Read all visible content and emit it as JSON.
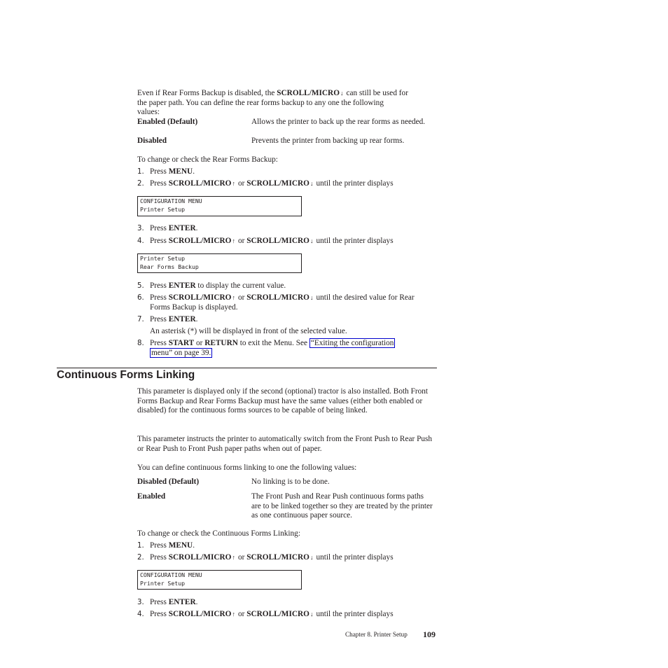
{
  "intro": {
    "text_before": "Even if Rear Forms Backup is disabled, the ",
    "key": "SCROLL/MICRO",
    "text_after_line1": "can still be used for",
    "line2": "the paper path. You can define the rear forms backup to any one the following",
    "line3": "values:"
  },
  "rear_values": [
    {
      "term": "Enabled (Default)",
      "desc": "Allows the printer to back up the rear forms as needed."
    },
    {
      "term": "Disabled",
      "desc": "Prevents the printer from backing up rear forms."
    }
  ],
  "rear_procedure": {
    "intro": "To change or check the Rear Forms Backup:",
    "steps": {
      "s1": {
        "num": "1.",
        "pre": "Press ",
        "key": "MENU",
        "post": "."
      },
      "s2": {
        "num": "2.",
        "pre": "Press ",
        "key1": "SCROLL/MICRO",
        "mid": "or ",
        "key2": "SCROLL/MICRO",
        "post": "until the printer displays"
      },
      "lcd1": {
        "line1": "CONFIGURATION MENU",
        "line2": "Printer Setup"
      },
      "s3": {
        "num": "3.",
        "pre": "Press ",
        "key": "ENTER",
        "post": "."
      },
      "s4": {
        "num": "4.",
        "pre": "Press ",
        "key1": "SCROLL/MICRO",
        "mid": "or ",
        "key2": "SCROLL/MICRO",
        "post": "until the printer displays"
      },
      "lcd2": {
        "line1": "Printer Setup",
        "line2": "Rear Forms Backup"
      },
      "s5": {
        "num": "5.",
        "pre": "Press ",
        "key": "ENTER",
        "post": " to display the current value."
      },
      "s6": {
        "num": "6.",
        "pre": "Press ",
        "key1": "SCROLL/MICRO",
        "mid": "or ",
        "key2": "SCROLL/MICRO",
        "post": "until the desired value for Rear",
        "line2": "Forms Backup is displayed."
      },
      "s7": {
        "num": "7.",
        "pre": "Press ",
        "key": "ENTER",
        "post": ".",
        "note": "An asterisk (*) will be displayed in front of the selected value."
      },
      "s8": {
        "num": "8.",
        "pre": "Press ",
        "key1": "START",
        "mid": " or ",
        "key2": "RETURN",
        "post": " to exit the Menu. See ",
        "link_line1": "“Exiting the configuration",
        "link_line2": "menu” on page 39."
      }
    }
  },
  "section": {
    "title": "Continuous Forms Linking",
    "para1": "This parameter is displayed only if the second (optional) tractor is also installed. Both Front Forms Backup and Rear Forms Backup must have the same values (either both enabled or disabled) for the continuous forms sources to be capable of being linked.",
    "para2": "This parameter instructs the printer to automatically switch from the Front Push to Rear Push or Rear Push to Front Push paper paths when out of paper.",
    "para3": "You can define continuous forms linking to one the following values:",
    "values": [
      {
        "term": "Disabled (Default)",
        "desc": "No linking is to be done."
      },
      {
        "term": "Enabled",
        "desc": "The Front Push and Rear Push continuous forms paths are to be linked together so they are treated by the printer as one continuous paper source."
      }
    ],
    "procedure_intro": "To change or check the Continuous Forms Linking:",
    "steps": {
      "s1": {
        "num": "1.",
        "pre": "Press ",
        "key": "MENU",
        "post": "."
      },
      "s2": {
        "num": "2.",
        "pre": "Press ",
        "key1": "SCROLL/MICRO",
        "mid": "or ",
        "key2": "SCROLL/MICRO",
        "post": "until the printer displays"
      },
      "lcd1": {
        "line1": "CONFIGURATION MENU",
        "line2": "Printer Setup"
      },
      "s3": {
        "num": "3.",
        "pre": "Press ",
        "key": "ENTER",
        "post": "."
      },
      "s4": {
        "num": "4.",
        "pre": "Press ",
        "key1": "SCROLL/MICRO",
        "mid": "or ",
        "key2": "SCROLL/MICRO",
        "post": "until the printer displays"
      }
    }
  },
  "icons": {
    "up": "↑",
    "down": "↓"
  },
  "footer": {
    "chapter": "Chapter 8. Printer Setup",
    "page": "109"
  }
}
